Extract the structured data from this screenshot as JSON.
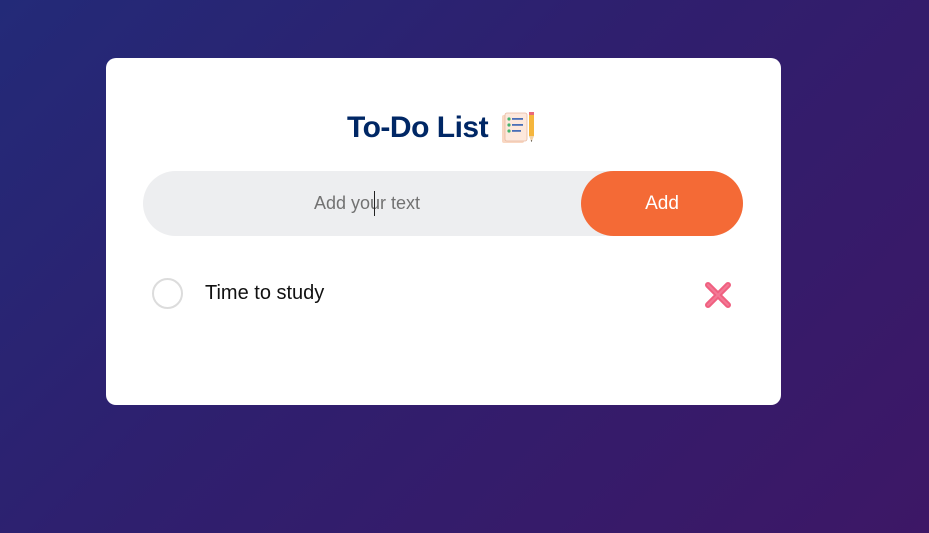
{
  "app": {
    "title": "To-Do List",
    "title_icon": "notepad-checklist-icon"
  },
  "input": {
    "placeholder": "Add your text",
    "value": ""
  },
  "add_button": {
    "label": "Add"
  },
  "tasks": [
    {
      "text": "Time to study",
      "checked": false
    }
  ],
  "colors": {
    "background_start": "#232a78",
    "background_end": "#3d1766",
    "title": "#002765",
    "accent": "#f46a36",
    "delete": "#f06080"
  }
}
